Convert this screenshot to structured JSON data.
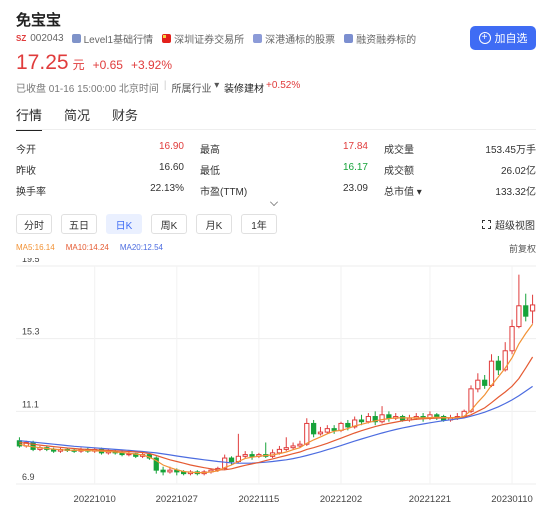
{
  "stock": {
    "name": "免宝宝",
    "market": "SZ",
    "code": "002043",
    "badges": [
      "Level1基础行情",
      "深圳证券交易所",
      "深港通标的股票",
      "融资融券标的"
    ],
    "follow_label": "加自选",
    "price": "17.25",
    "unit": "元",
    "change": "+0.65",
    "change_pct": "+3.92%",
    "status_time": "已收盘 01-16 15:00:00 北京时间",
    "industry_label": "所属行业",
    "industry_name": "装修建材",
    "industry_pct": "+0.52%"
  },
  "tabs": [
    "行情",
    "简况",
    "财务"
  ],
  "stats": [
    [
      {
        "label": "今开",
        "value": "16.90",
        "color": "red"
      },
      {
        "label": "最高",
        "value": "17.84",
        "color": "red"
      },
      {
        "label": "成交量",
        "value": "153.45万手"
      }
    ],
    [
      {
        "label": "昨收",
        "value": "16.60"
      },
      {
        "label": "最低",
        "value": "16.17",
        "color": "green"
      },
      {
        "label": "成交额",
        "value": "26.02亿"
      }
    ],
    [
      {
        "label": "换手率",
        "value": "22.13%"
      },
      {
        "label": "市盈(TTM)",
        "value": "23.09"
      },
      {
        "label": "总市值 ▾",
        "value": "133.32亿"
      }
    ]
  ],
  "periods": [
    "分时",
    "五日",
    "日K",
    "周K",
    "月K",
    "1年"
  ],
  "active_period": "日K",
  "super_view_label": "超级视图",
  "ma": {
    "ma5": "MA5:16.14",
    "ma10": "MA10:14.24",
    "ma20": "MA20:12.54"
  },
  "adjust_label": "前复权",
  "colors": {
    "up": "#e03c3c",
    "down": "#16a33a",
    "accent": "#3f6cf4",
    "ma5": "#f29235",
    "ma10": "#e55b33",
    "ma20": "#4c6ce0"
  },
  "chart_data": {
    "type": "candlestick",
    "y_ticks": [
      19.5,
      15.3,
      11.1,
      6.9
    ],
    "x_ticks": [
      "20221010",
      "20221027",
      "20221115",
      "20221202",
      "20221221",
      "20230110"
    ],
    "ylim": [
      6.9,
      19.5
    ],
    "candles": [
      [
        9.4,
        9.1,
        9.6,
        9.0
      ],
      [
        9.1,
        9.3,
        9.4,
        9.0
      ],
      [
        9.3,
        8.9,
        9.4,
        8.8
      ],
      [
        8.9,
        9.0,
        9.1,
        8.8
      ],
      [
        9.0,
        8.9,
        9.1,
        8.8
      ],
      [
        8.9,
        8.8,
        9.0,
        8.7
      ],
      [
        8.8,
        8.9,
        9.0,
        8.7
      ],
      [
        8.9,
        8.85,
        9.0,
        8.75
      ],
      [
        8.85,
        8.8,
        8.95,
        8.7
      ],
      [
        8.8,
        8.9,
        9.0,
        8.7
      ],
      [
        8.9,
        8.8,
        9.0,
        8.7
      ],
      [
        8.8,
        8.9,
        9.0,
        8.7
      ],
      [
        8.9,
        8.7,
        9.0,
        8.6
      ],
      [
        8.7,
        8.8,
        8.9,
        8.6
      ],
      [
        8.8,
        8.7,
        8.9,
        8.6
      ],
      [
        8.7,
        8.6,
        8.8,
        8.5
      ],
      [
        8.6,
        8.65,
        8.75,
        8.5
      ],
      [
        8.65,
        8.5,
        8.7,
        8.4
      ],
      [
        8.5,
        8.6,
        8.7,
        8.4
      ],
      [
        8.6,
        8.4,
        8.7,
        8.3
      ],
      [
        8.4,
        7.7,
        8.5,
        7.5
      ],
      [
        7.7,
        7.6,
        7.9,
        7.4
      ],
      [
        7.6,
        7.7,
        7.9,
        7.5
      ],
      [
        7.7,
        7.6,
        7.8,
        7.4
      ],
      [
        7.6,
        7.5,
        7.7,
        7.4
      ],
      [
        7.5,
        7.6,
        7.7,
        7.4
      ],
      [
        7.6,
        7.5,
        7.7,
        7.4
      ],
      [
        7.5,
        7.6,
        7.7,
        7.4
      ],
      [
        7.6,
        7.7,
        7.8,
        7.5
      ],
      [
        7.7,
        7.8,
        7.9,
        7.6
      ],
      [
        7.8,
        8.4,
        8.6,
        7.7
      ],
      [
        8.4,
        8.2,
        8.5,
        8.0
      ],
      [
        8.2,
        8.5,
        9.8,
        8.1
      ],
      [
        8.5,
        8.6,
        8.8,
        8.4
      ],
      [
        8.6,
        8.5,
        8.8,
        8.3
      ],
      [
        8.5,
        8.6,
        8.7,
        8.4
      ],
      [
        8.6,
        8.5,
        9.3,
        8.4
      ],
      [
        8.5,
        8.7,
        8.9,
        8.4
      ],
      [
        8.7,
        8.9,
        9.1,
        8.6
      ],
      [
        8.9,
        9.0,
        9.6,
        8.8
      ],
      [
        9.0,
        9.1,
        9.3,
        8.9
      ],
      [
        9.1,
        9.2,
        9.4,
        9.0
      ],
      [
        9.2,
        10.4,
        10.7,
        9.1
      ],
      [
        10.4,
        9.8,
        10.6,
        9.6
      ],
      [
        9.8,
        9.9,
        10.2,
        9.7
      ],
      [
        9.9,
        10.1,
        10.3,
        9.8
      ],
      [
        10.1,
        10.0,
        10.3,
        9.8
      ],
      [
        10.0,
        10.4,
        10.5,
        9.9
      ],
      [
        10.4,
        10.2,
        10.6,
        10.0
      ],
      [
        10.2,
        10.6,
        10.8,
        10.1
      ],
      [
        10.6,
        10.5,
        10.9,
        10.3
      ],
      [
        10.5,
        10.8,
        11.0,
        10.4
      ],
      [
        10.8,
        10.5,
        11.1,
        10.3
      ],
      [
        10.5,
        10.9,
        11.4,
        10.4
      ],
      [
        10.9,
        10.7,
        11.1,
        10.5
      ],
      [
        10.7,
        10.8,
        11.0,
        10.6
      ],
      [
        10.8,
        10.6,
        10.9,
        10.5
      ],
      [
        10.6,
        10.7,
        10.9,
        10.5
      ],
      [
        10.7,
        10.8,
        11.0,
        10.6
      ],
      [
        10.8,
        10.7,
        11.0,
        10.5
      ],
      [
        10.7,
        10.9,
        11.1,
        10.6
      ],
      [
        10.9,
        10.8,
        11.0,
        10.6
      ],
      [
        10.8,
        10.6,
        10.9,
        10.5
      ],
      [
        10.6,
        10.7,
        10.9,
        10.5
      ],
      [
        10.7,
        10.8,
        11.0,
        10.6
      ],
      [
        10.8,
        11.1,
        11.2,
        10.7
      ],
      [
        11.1,
        12.4,
        12.6,
        11.0
      ],
      [
        12.4,
        12.9,
        13.3,
        12.2
      ],
      [
        12.9,
        12.6,
        13.2,
        12.4
      ],
      [
        12.6,
        14.0,
        14.4,
        12.5
      ],
      [
        14.0,
        13.5,
        14.3,
        13.2
      ],
      [
        13.5,
        14.6,
        15.1,
        13.4
      ],
      [
        14.6,
        16.0,
        16.4,
        14.4
      ],
      [
        16.0,
        17.2,
        19.0,
        15.9
      ],
      [
        17.2,
        16.6,
        17.9,
        16.3
      ],
      [
        16.9,
        17.25,
        17.84,
        16.17
      ]
    ],
    "ma5": [
      9.2,
      9.1,
      9.05,
      9.0,
      8.95,
      8.92,
      8.88,
      8.86,
      8.85,
      8.85,
      8.83,
      8.82,
      8.8,
      8.78,
      8.75,
      8.72,
      8.68,
      8.63,
      8.58,
      8.45,
      8.25,
      8.0,
      7.85,
      7.72,
      7.62,
      7.58,
      7.56,
      7.56,
      7.6,
      7.66,
      7.85,
      8.0,
      8.2,
      8.38,
      8.45,
      8.5,
      8.55,
      8.58,
      8.65,
      8.75,
      8.88,
      9.0,
      9.25,
      9.45,
      9.62,
      9.8,
      9.95,
      10.0,
      10.1,
      10.25,
      10.35,
      10.45,
      10.55,
      10.62,
      10.68,
      10.72,
      10.72,
      10.72,
      10.72,
      10.72,
      10.74,
      10.76,
      10.74,
      10.72,
      10.72,
      10.82,
      11.15,
      11.62,
      12.05,
      12.6,
      13.1,
      13.6,
      14.2,
      15.0,
      15.6,
      16.14
    ],
    "ma10": [
      9.3,
      9.25,
      9.2,
      9.15,
      9.1,
      9.06,
      9.02,
      8.98,
      8.95,
      8.92,
      8.9,
      8.88,
      8.86,
      8.84,
      8.82,
      8.8,
      8.78,
      8.75,
      8.72,
      8.66,
      8.55,
      8.42,
      8.3,
      8.2,
      8.1,
      8.0,
      7.92,
      7.84,
      7.78,
      7.72,
      7.72,
      7.78,
      7.88,
      7.98,
      8.06,
      8.15,
      8.25,
      8.35,
      8.45,
      8.55,
      8.65,
      8.75,
      8.9,
      9.0,
      9.12,
      9.25,
      9.4,
      9.55,
      9.7,
      9.85,
      9.98,
      10.1,
      10.22,
      10.32,
      10.4,
      10.48,
      10.55,
      10.6,
      10.64,
      10.67,
      10.69,
      10.71,
      10.72,
      10.73,
      10.74,
      10.78,
      10.9,
      11.1,
      11.3,
      11.6,
      11.92,
      12.22,
      12.55,
      13.0,
      13.6,
      14.24
    ],
    "ma20": [
      9.4,
      9.36,
      9.32,
      9.28,
      9.24,
      9.2,
      9.16,
      9.12,
      9.08,
      9.05,
      9.02,
      8.99,
      8.96,
      8.93,
      8.9,
      8.87,
      8.84,
      8.81,
      8.78,
      8.74,
      8.7,
      8.64,
      8.58,
      8.52,
      8.46,
      8.4,
      8.35,
      8.3,
      8.25,
      8.2,
      8.16,
      8.12,
      8.1,
      8.1,
      8.11,
      8.13,
      8.16,
      8.2,
      8.25,
      8.3,
      8.37,
      8.45,
      8.55,
      8.65,
      8.76,
      8.88,
      9.0,
      9.12,
      9.25,
      9.38,
      9.5,
      9.62,
      9.74,
      9.85,
      9.95,
      10.05,
      10.14,
      10.22,
      10.3,
      10.37,
      10.44,
      10.5,
      10.56,
      10.61,
      10.66,
      10.72,
      10.82,
      10.93,
      11.05,
      11.2,
      11.36,
      11.55,
      11.76,
      12.0,
      12.27,
      12.54
    ]
  }
}
